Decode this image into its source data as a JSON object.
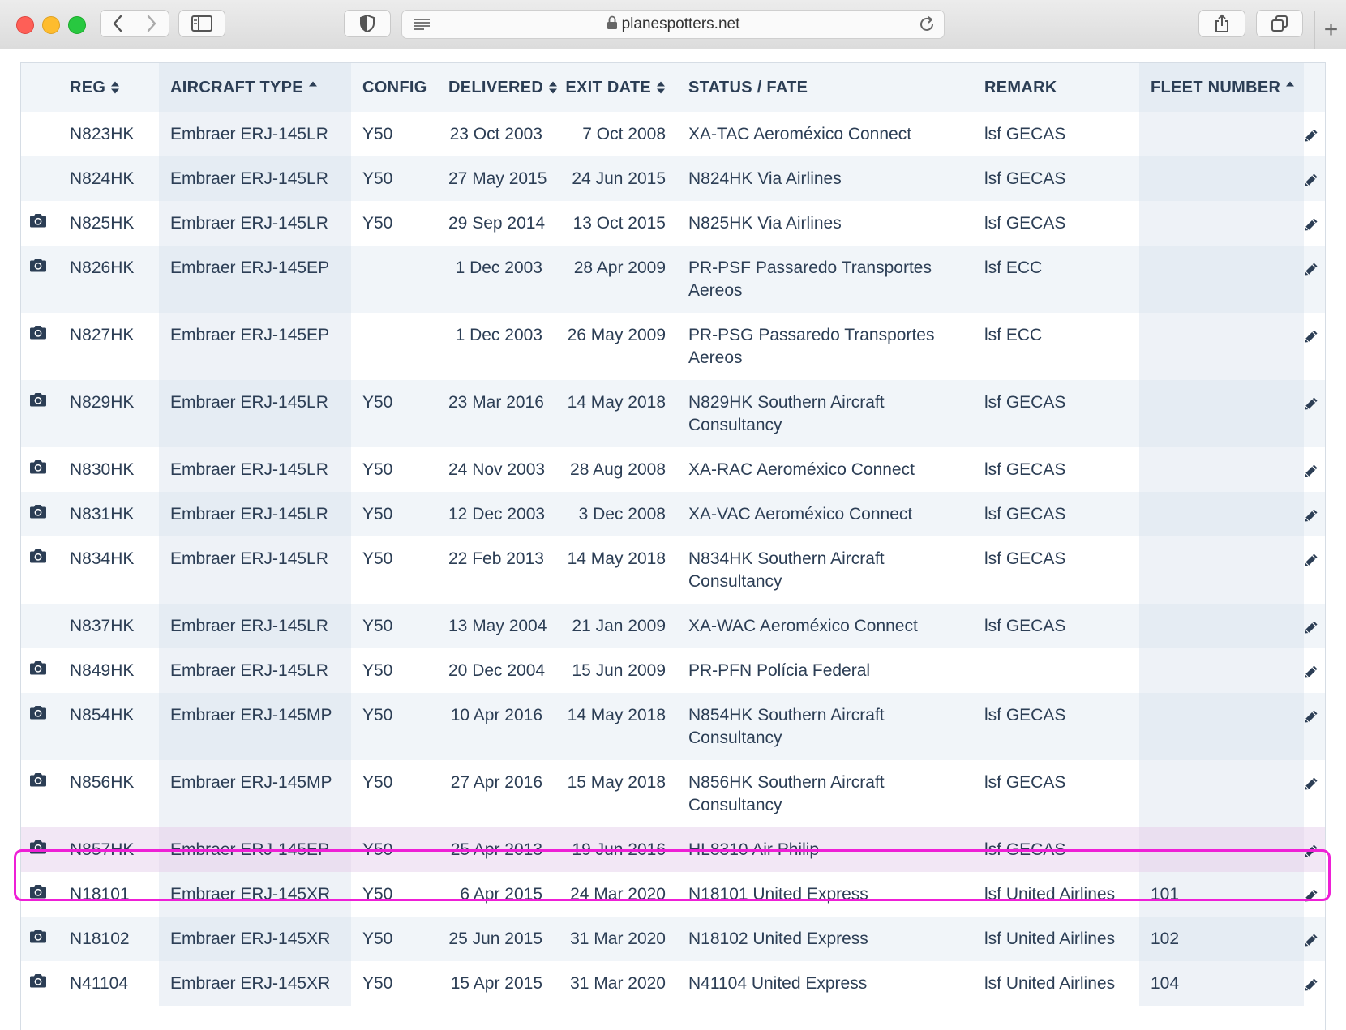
{
  "browser": {
    "url": "planespotters.net"
  },
  "table": {
    "headers": {
      "reg": "REG",
      "aircraft_type": "AIRCRAFT TYPE",
      "config": "CONFIG",
      "delivered": "DELIVERED",
      "exit_date": "EXIT DATE",
      "status_fate": "STATUS / FATE",
      "remark": "REMARK",
      "fleet_number": "FLEET NUMBER"
    },
    "rows": [
      {
        "photo": false,
        "reg": "N823HK",
        "type": "Embraer ERJ-145LR",
        "config": "Y50",
        "delivered": "23 Oct 2003",
        "exit": "7 Oct 2008",
        "status": "XA-TAC Aeroméxico Connect",
        "remark": "lsf GECAS",
        "fleet": ""
      },
      {
        "photo": false,
        "reg": "N824HK",
        "type": "Embraer ERJ-145LR",
        "config": "Y50",
        "delivered": "27 May 2015",
        "exit": "24 Jun 2015",
        "status": "N824HK Via Airlines",
        "remark": "lsf GECAS",
        "fleet": ""
      },
      {
        "photo": true,
        "reg": "N825HK",
        "type": "Embraer ERJ-145LR",
        "config": "Y50",
        "delivered": "29 Sep 2014",
        "exit": "13 Oct 2015",
        "status": "N825HK Via Airlines",
        "remark": "lsf GECAS",
        "fleet": ""
      },
      {
        "photo": true,
        "reg": "N826HK",
        "type": "Embraer ERJ-145EP",
        "config": "",
        "delivered": "1 Dec 2003",
        "exit": "28 Apr 2009",
        "status": "PR-PSF Passaredo Transportes Aereos",
        "remark": "lsf ECC",
        "fleet": ""
      },
      {
        "photo": true,
        "reg": "N827HK",
        "type": "Embraer ERJ-145EP",
        "config": "",
        "delivered": "1 Dec 2003",
        "exit": "26 May 2009",
        "status": "PR-PSG Passaredo Transportes Aereos",
        "remark": "lsf ECC",
        "fleet": ""
      },
      {
        "photo": true,
        "reg": "N829HK",
        "type": "Embraer ERJ-145LR",
        "config": "Y50",
        "delivered": "23 Mar 2016",
        "exit": "14 May 2018",
        "status": "N829HK Southern Aircraft Consultancy",
        "remark": "lsf GECAS",
        "fleet": ""
      },
      {
        "photo": true,
        "reg": "N830HK",
        "type": "Embraer ERJ-145LR",
        "config": "Y50",
        "delivered": "24 Nov 2003",
        "exit": "28 Aug 2008",
        "status": "XA-RAC Aeroméxico Connect",
        "remark": "lsf GECAS",
        "fleet": ""
      },
      {
        "photo": true,
        "reg": "N831HK",
        "type": "Embraer ERJ-145LR",
        "config": "Y50",
        "delivered": "12 Dec 2003",
        "exit": "3 Dec 2008",
        "status": "XA-VAC Aeroméxico Connect",
        "remark": "lsf GECAS",
        "fleet": ""
      },
      {
        "photo": true,
        "reg": "N834HK",
        "type": "Embraer ERJ-145LR",
        "config": "Y50",
        "delivered": "22 Feb 2013",
        "exit": "14 May 2018",
        "status": "N834HK Southern Aircraft Consultancy",
        "remark": "lsf GECAS",
        "fleet": ""
      },
      {
        "photo": false,
        "reg": "N837HK",
        "type": "Embraer ERJ-145LR",
        "config": "Y50",
        "delivered": "13 May 2004",
        "exit": "21 Jan 2009",
        "status": "XA-WAC Aeroméxico Connect",
        "remark": "lsf GECAS",
        "fleet": ""
      },
      {
        "photo": true,
        "reg": "N849HK",
        "type": "Embraer ERJ-145LR",
        "config": "Y50",
        "delivered": "20 Dec 2004",
        "exit": "15 Jun 2009",
        "status": "PR-PFN Polícia Federal",
        "remark": "",
        "fleet": ""
      },
      {
        "photo": true,
        "reg": "N854HK",
        "type": "Embraer ERJ-145MP",
        "config": "Y50",
        "delivered": "10 Apr 2016",
        "exit": "14 May 2018",
        "status": "N854HK Southern Aircraft Consultancy",
        "remark": "lsf GECAS",
        "fleet": ""
      },
      {
        "photo": true,
        "reg": "N856HK",
        "type": "Embraer ERJ-145MP",
        "config": "Y50",
        "delivered": "27 Apr 2016",
        "exit": "15 May 2018",
        "status": "N856HK Southern Aircraft Consultancy",
        "remark": "lsf GECAS",
        "fleet": ""
      },
      {
        "photo": true,
        "reg": "N857HK",
        "type": "Embraer ERJ-145EP",
        "config": "Y50",
        "delivered": "25 Apr 2013",
        "exit": "19 Jun 2016",
        "status": "HL8310 Air Philip",
        "remark": "lsf GECAS",
        "fleet": "",
        "highlighted": true
      },
      {
        "photo": true,
        "reg": "N18101",
        "type": "Embraer ERJ-145XR",
        "config": "Y50",
        "delivered": "6 Apr 2015",
        "exit": "24 Mar 2020",
        "status": "N18101 United Express",
        "remark": "lsf United Airlines",
        "fleet": "101"
      },
      {
        "photo": true,
        "reg": "N18102",
        "type": "Embraer ERJ-145XR",
        "config": "Y50",
        "delivered": "25 Jun 2015",
        "exit": "31 Mar 2020",
        "status": "N18102 United Express",
        "remark": "lsf United Airlines",
        "fleet": "102"
      },
      {
        "photo": true,
        "reg": "N41104",
        "type": "Embraer ERJ-145XR",
        "config": "Y50",
        "delivered": "15 Apr 2015",
        "exit": "31 Mar 2020",
        "status": "N41104 United Express",
        "remark": "lsf United Airlines",
        "fleet": "104"
      }
    ]
  },
  "icons": {
    "photo": "camera-icon",
    "edit": "pencil-icon",
    "sort_both": "sort-both-icon",
    "sort_up": "sort-ascending-icon"
  },
  "colors": {
    "text": "#2c3e55",
    "stripe": "#f1f5f9",
    "sorted_column": "#e5ecf3",
    "highlight_border": "#ee1fd6",
    "highlight_fill": "#f2e7f5"
  }
}
